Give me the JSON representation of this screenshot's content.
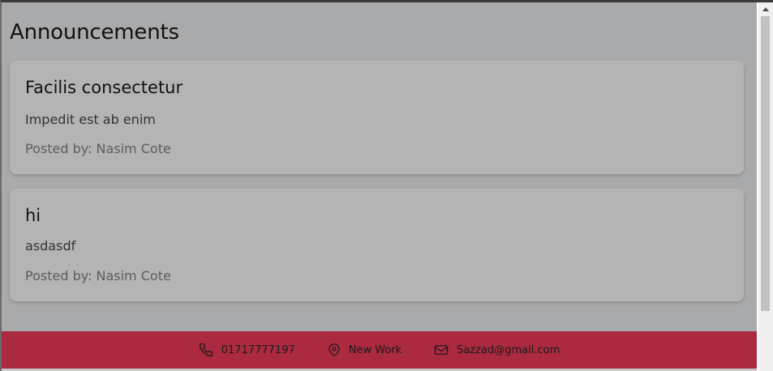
{
  "page": {
    "title": "Announcements"
  },
  "announcements": [
    {
      "title": "Facilis consectetur",
      "description": "Impedit est ab enim",
      "posted_by": "Posted by: Nasim Cote"
    },
    {
      "title": "hi",
      "description": "asdasdf",
      "posted_by": "Posted by: Nasim Cote"
    }
  ],
  "footer": {
    "phone": "01717777197",
    "location": "New Work",
    "email": "Sazzad@gmail.com",
    "background_color": "#ac2a40"
  },
  "icons": {
    "phone": "phone-icon",
    "location": "location-pin-icon",
    "email": "mail-icon"
  }
}
